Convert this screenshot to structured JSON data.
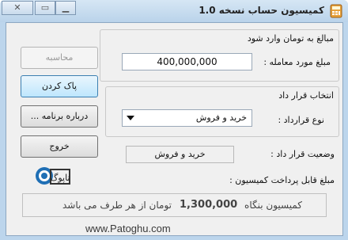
{
  "window": {
    "title": "کمیسیون حساب   نسخه 1.0",
    "controls": {
      "close": "✕",
      "maximize": "▭",
      "minimize": "▁"
    }
  },
  "amount_section": {
    "heading": "مبالغ به تومان وارد شود",
    "deal_amount_label": "مبلغ مورد معامله :",
    "deal_amount_value": "400,000,000"
  },
  "contract_section": {
    "heading": "انتخاب قرار داد",
    "contract_type_label": "نوع قرارداد :",
    "contract_type_value": "خرید و فروش",
    "status_label": "وضعیت  قرار داد :",
    "status_value": "خرید و فروش"
  },
  "commission": {
    "label": "مبلغ  قابل پرداخت کمیسیون :",
    "result_prefix": "کمیسیون بنگاه",
    "result_amount": "1,300,000",
    "result_suffix": "تومان از هر طرف می باشد"
  },
  "buttons": {
    "calculate": "محاسبه",
    "clear": "پاک کردن",
    "about": "درباره برنامه ...",
    "exit": "خروج"
  },
  "branding": {
    "logo_text": "تاپوگ",
    "watermark": "www.Patoghu.com"
  },
  "icons": {
    "app": "calculator-icon",
    "dropdown": "dropdown-arrow-icon"
  }
}
